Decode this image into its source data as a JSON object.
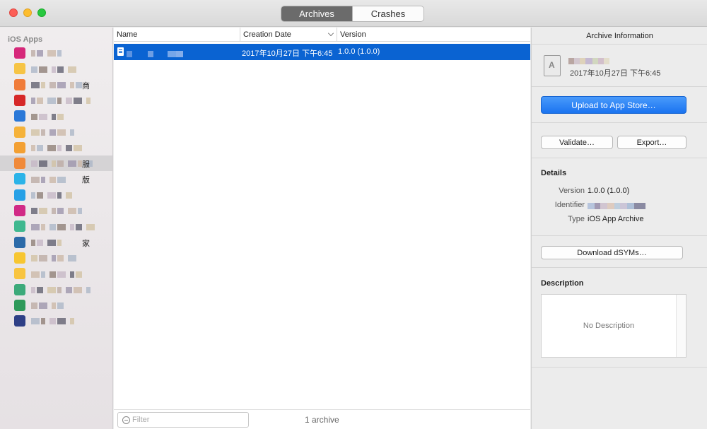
{
  "window": {
    "tabs": [
      {
        "label": "Archives",
        "active": true
      },
      {
        "label": "Crashes",
        "active": false
      }
    ]
  },
  "sidebar": {
    "header": "iOS Apps",
    "items": [
      {
        "icon_color": "#d6287a",
        "suffix": "",
        "selected": false
      },
      {
        "icon_color": "#f6c445",
        "suffix": "",
        "selected": false
      },
      {
        "icon_color": "#f07c3a",
        "suffix": "商",
        "selected": false
      },
      {
        "icon_color": "#d62828",
        "suffix": "",
        "selected": false
      },
      {
        "icon_color": "#2a78d8",
        "suffix": "",
        "selected": false
      },
      {
        "icon_color": "#f5b23a",
        "suffix": "",
        "selected": false
      },
      {
        "icon_color": "#f3a033",
        "suffix": "",
        "selected": false
      },
      {
        "icon_color": "#f08a3a",
        "suffix": "服",
        "selected": true
      },
      {
        "icon_color": "#2bb3e8",
        "suffix": "版",
        "selected": false
      },
      {
        "icon_color": "#27a0e6",
        "suffix": "",
        "selected": false
      },
      {
        "icon_color": "#d12a86",
        "suffix": "",
        "selected": false
      },
      {
        "icon_color": "#3fb88f",
        "suffix": "",
        "selected": false
      },
      {
        "icon_color": "#2c6aa8",
        "suffix": "家",
        "selected": false
      },
      {
        "icon_color": "#f7c631",
        "suffix": "",
        "selected": false
      },
      {
        "icon_color": "#f8c440",
        "suffix": "",
        "selected": false
      },
      {
        "icon_color": "#3caa7a",
        "suffix": "",
        "selected": false
      },
      {
        "icon_color": "#2e9a5a",
        "suffix": "",
        "selected": false
      },
      {
        "icon_color": "#2e3f86",
        "suffix": "",
        "selected": false
      }
    ]
  },
  "list": {
    "columns": {
      "name": "Name",
      "date": "Creation Date",
      "version": "Version"
    },
    "rows": [
      {
        "date": "2017年10月27日 下午6:45",
        "version": "1.0.0 (1.0.0)"
      }
    ],
    "filter_placeholder": "Filter",
    "count": "1 archive"
  },
  "inspector": {
    "title": "Archive Information",
    "archive_date": "2017年10月27日 下午6:45",
    "upload_label": "Upload to App Store…",
    "validate_label": "Validate…",
    "export_label": "Export…",
    "details_header": "Details",
    "version_label": "Version",
    "version_value": "1.0.0 (1.0.0)",
    "identifier_label": "Identifier",
    "type_label": "Type",
    "type_value": "iOS App Archive",
    "dsym_label": "Download dSYMs…",
    "description_header": "Description",
    "description_empty": "No Description"
  },
  "colors": {
    "selection": "#0a63d2",
    "primary_button": "#1a73f0"
  }
}
